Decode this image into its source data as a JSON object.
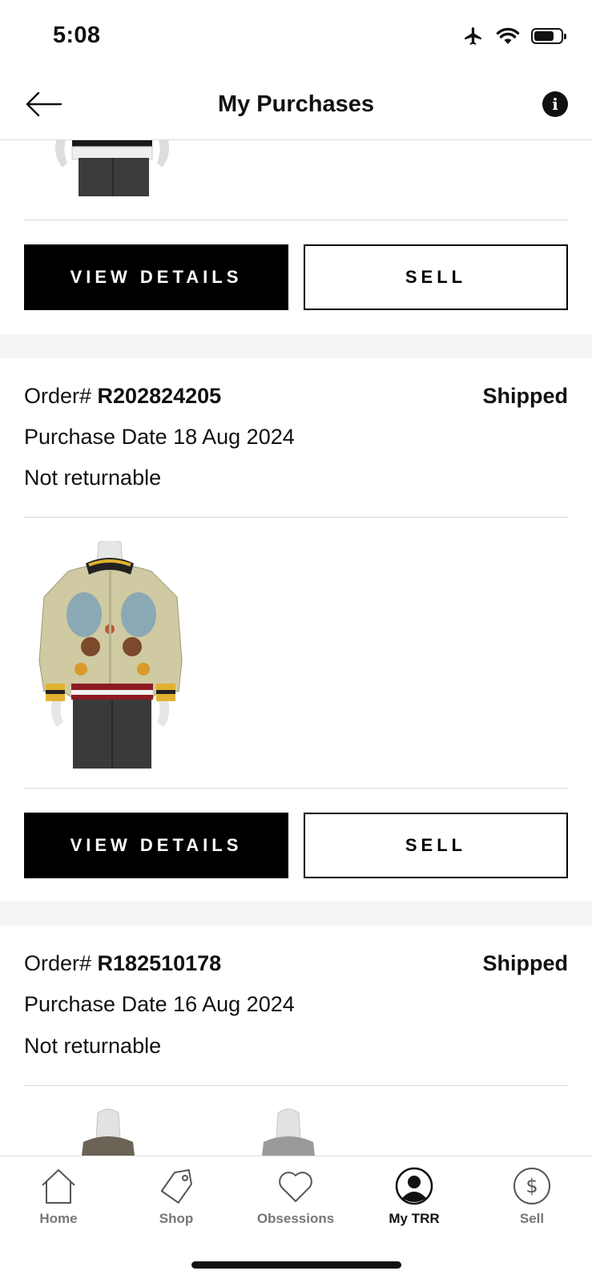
{
  "status_bar": {
    "time": "5:08"
  },
  "header": {
    "title": "My Purchases"
  },
  "buttons": {
    "view_details": "VIEW DETAILS",
    "sell": "SELL"
  },
  "orders": [
    {
      "prefix": "Order# ",
      "number": "R202824205",
      "status": "Shipped",
      "purchase_date": "Purchase Date 18 Aug 2024",
      "returnable": "Not returnable"
    },
    {
      "prefix": "Order# ",
      "number": "R182510178",
      "status": "Shipped",
      "purchase_date": "Purchase Date 16 Aug 2024",
      "returnable": "Not returnable"
    }
  ],
  "tabbar": {
    "items": [
      {
        "label": "Home",
        "icon": "house-icon"
      },
      {
        "label": "Shop",
        "icon": "tag-icon"
      },
      {
        "label": "Obsessions",
        "icon": "heart-icon"
      },
      {
        "label": "My TRR",
        "icon": "person-icon",
        "active": true
      },
      {
        "label": "Sell",
        "icon": "dollar-icon"
      }
    ]
  }
}
